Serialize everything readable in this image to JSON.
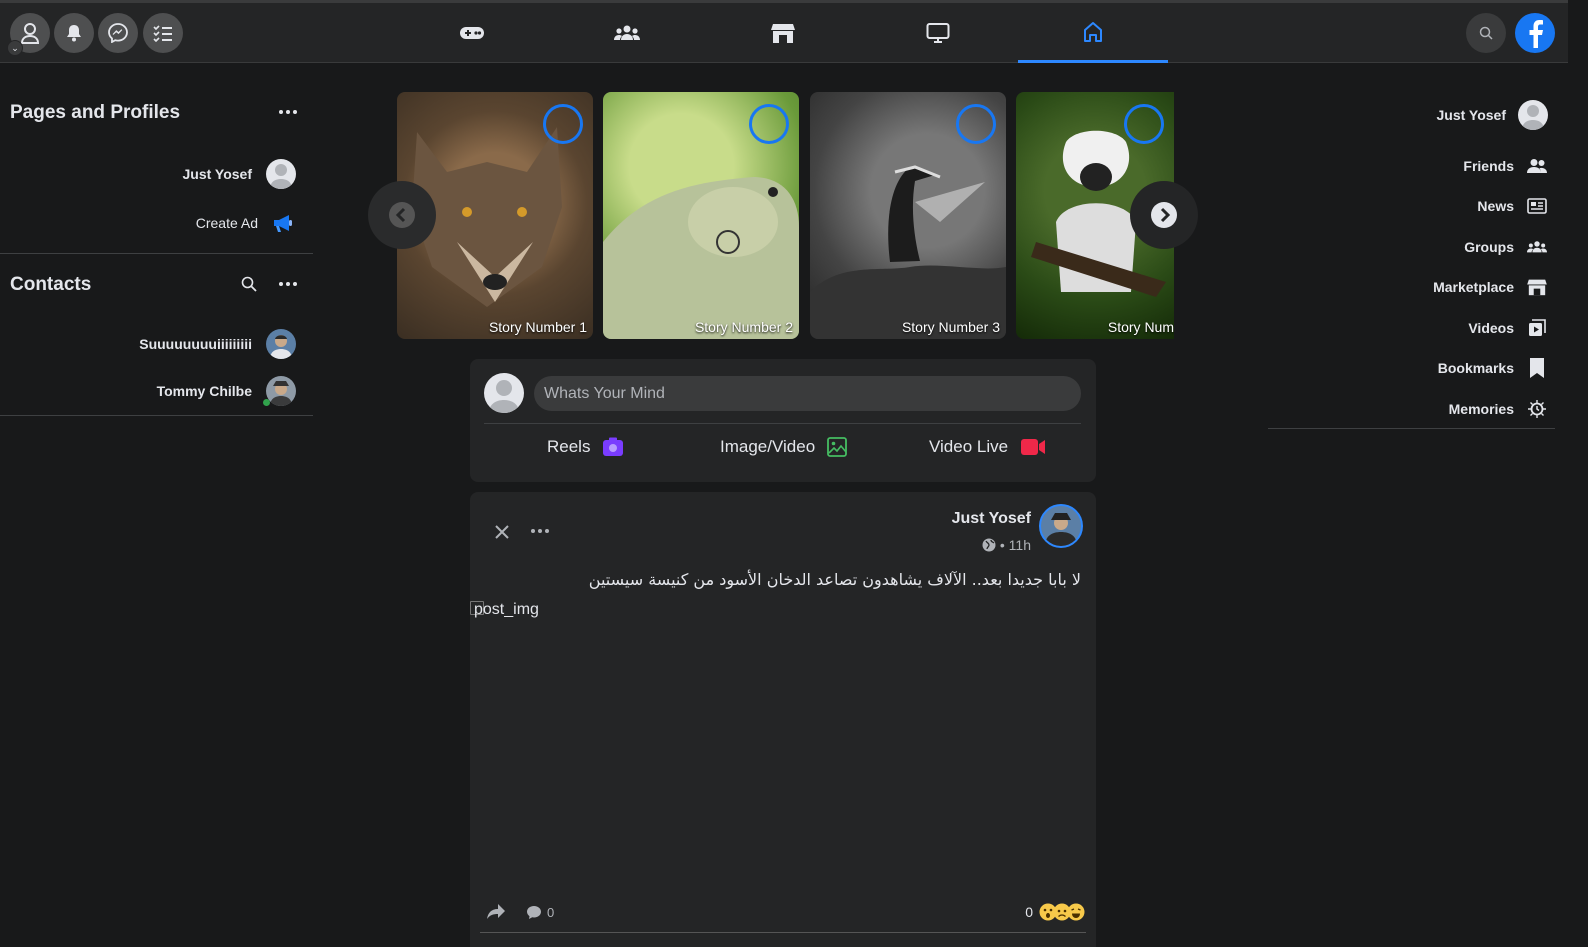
{
  "nav": {
    "tabs": [
      {
        "icon": "gamepad-icon"
      },
      {
        "icon": "groups-icon"
      },
      {
        "icon": "marketplace-icon"
      },
      {
        "icon": "watch-icon"
      },
      {
        "icon": "home-icon",
        "active": true
      }
    ]
  },
  "left": {
    "pages_title": "Pages and Profiles",
    "profile_name": "Just Yosef",
    "create_ad": "Create Ad",
    "contacts_title": "Contacts",
    "contacts": [
      {
        "name": "Suuuuuuuuiiiiiiiii",
        "online": false
      },
      {
        "name": "Tommy Chilbe",
        "online": true
      }
    ]
  },
  "stories": [
    {
      "label": "Story Number 1"
    },
    {
      "label": "Story Number 2"
    },
    {
      "label": "Story Number 3"
    },
    {
      "label": "Story Num"
    }
  ],
  "composer": {
    "placeholder": "Whats Your Mind",
    "reels": "Reels",
    "image_video": "Image/Video",
    "video_live": "Video Live"
  },
  "post": {
    "author": "Just Yosef",
    "time": "• 11h",
    "text": "لا بابا جديدا بعد.. الآلاف يشاهدون تصاعد الدخان الأسود من كنيسة سيستين",
    "image_alt": "post_img",
    "comments_count": "0",
    "reactions_count": "0"
  },
  "right": {
    "profile_name": "Just Yosef",
    "items": [
      "Friends",
      "News",
      "Groups",
      "Marketplace",
      "Videos",
      "Bookmarks",
      "Memories"
    ]
  },
  "colors": {
    "accent": "#2d88ff",
    "bg": "#18191a",
    "card": "#242526"
  }
}
